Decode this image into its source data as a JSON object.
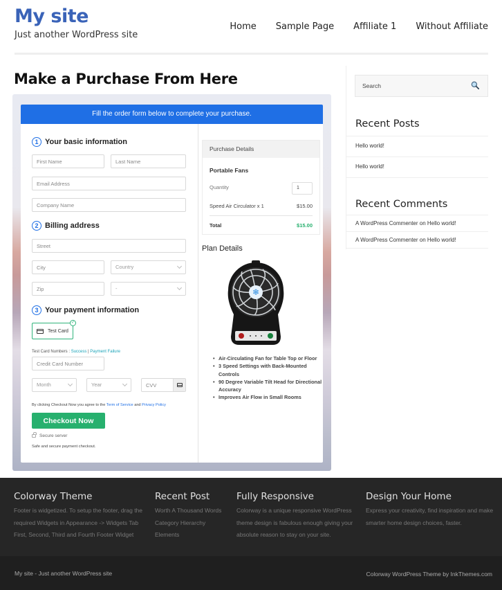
{
  "header": {
    "site_title": "My site",
    "tagline": "Just another WordPress site",
    "nav": [
      {
        "label": "Home"
      },
      {
        "label": "Sample Page"
      },
      {
        "label": "Affiliate 1"
      },
      {
        "label": "Without Affiliate"
      }
    ]
  },
  "main": {
    "page_title": "Make a Purchase From Here",
    "form": {
      "banner": "Fill the order form below to complete your purchase.",
      "steps": [
        {
          "num": "1",
          "label": "Your basic information"
        },
        {
          "num": "2",
          "label": "Billing address"
        },
        {
          "num": "3",
          "label": "Your payment information"
        }
      ],
      "fields": {
        "first_name": "First Name",
        "last_name": "Last Name",
        "email": "Email Address",
        "company": "Company Name",
        "street": "Street",
        "city": "City",
        "country": "Country",
        "zip": "Zip",
        "state": "-",
        "card_number": "Credit Card Number",
        "month": "Month",
        "year": "Year",
        "cvv": "CVV"
      },
      "payment_option": "Test Card",
      "test_card_label": "Test Card Numbers : ",
      "test_success": "Success",
      "test_separator": " | ",
      "test_failure": "Payment Failure",
      "terms_prefix": "By clicking Checkout Now you agree to the ",
      "terms_link": "Term of Service",
      "terms_and": " and ",
      "privacy_link": "Privacy Policy",
      "checkout_label": "Checkout Now",
      "secure_label": "Secure server",
      "safe_note": "Safe and secure payment checkout."
    },
    "purchase": {
      "heading": "Purchase Details",
      "product": "Portable Fans",
      "quantity_label": "Quantity",
      "quantity": "1",
      "line_item": "Speed Air Circulator x 1",
      "line_price": "$15.00",
      "total_label": "Total",
      "total": "$15.00"
    },
    "plan": {
      "heading": "Plan Details",
      "image": "portable-fan-image",
      "features": [
        "Air-Circulating Fan for Table Top or Floor",
        "3 Speed Settings with Back-Mounted Controls",
        "90 Degree Variable Tilt Head for Directional Accuracy",
        "Improves Air Flow in Small Rooms"
      ]
    }
  },
  "sidebar": {
    "search_placeholder": "Search",
    "recent_posts_title": "Recent Posts",
    "recent_posts": [
      "Hello world!",
      "Hello world!"
    ],
    "recent_comments_title": "Recent Comments",
    "recent_comments": [
      "A WordPress Commenter on Hello world!",
      "A WordPress Commenter on Hello world!"
    ]
  },
  "footer": {
    "columns": [
      {
        "title": "Colorway Theme",
        "lines": [
          "Footer is widgetized. To setup the footer, drag the",
          "required Widgets in Appearance -> Widgets Tab",
          "First, Second, Third and Fourth Footer Widget"
        ]
      },
      {
        "title": "Recent Post",
        "lines": [
          "Worth A Thousand Words",
          "Category Hierarchy",
          "Elements"
        ]
      },
      {
        "title": "Fully Responsive",
        "lines": [
          "Colorway is a unique responsive WordPress",
          "theme design is fabulous enough giving your",
          "absolute reason to stay on your site."
        ]
      },
      {
        "title": "Design Your Home",
        "lines": [
          "Express your creativity, find inspiration and make",
          "smarter home design choices, faster."
        ]
      }
    ],
    "bottom_left": "My site - Just another WordPress site",
    "bottom_right": "Colorway WordPress Theme by InkThemes.com"
  },
  "colors": {
    "brand": "#3a63b8",
    "banner": "#1f6fe5",
    "checkout": "#27b06e",
    "footer_bg": "#262626"
  }
}
